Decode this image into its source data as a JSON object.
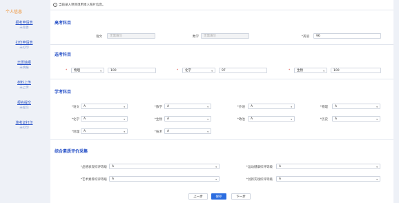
{
  "sidebar": {
    "header": "个人信息",
    "items": [
      {
        "title": "报考申请表",
        "status": "未完善"
      },
      {
        "title": "打印申请表",
        "status": "未打印"
      },
      {
        "title": "志愿填报",
        "status": "未填报"
      },
      {
        "title": "材料上传",
        "status": "未上传"
      },
      {
        "title": "报名提交",
        "status": "未提交"
      },
      {
        "title": "准考证打印",
        "status": "未打印"
      }
    ]
  },
  "notice": "当前录入项目须用本人照片信息。",
  "sections": {
    "gaokao": {
      "title": "高考科目",
      "chinese_label": "语文",
      "chinese_value": "无需填写",
      "math_label": "数学",
      "math_value": "无需填写",
      "english_label": "*英语",
      "english_value": "96"
    },
    "xuankao": {
      "title": "选考科目",
      "subjects": [
        {
          "subject": "物理",
          "score": "100"
        },
        {
          "subject": "化学",
          "score": "97"
        },
        {
          "subject": "生物",
          "score": "100"
        }
      ]
    },
    "xuekao": {
      "title": "学考科目",
      "items": [
        {
          "label": "*语文",
          "value": "A"
        },
        {
          "label": "*数学",
          "value": "A"
        },
        {
          "label": "*外语",
          "value": "A"
        },
        {
          "label": "*物理",
          "value": "A"
        },
        {
          "label": "*化学",
          "value": "A"
        },
        {
          "label": "*生物",
          "value": "A"
        },
        {
          "label": "*政治",
          "value": "A"
        },
        {
          "label": "*历史",
          "value": "A"
        },
        {
          "label": "*地理",
          "value": "A"
        },
        {
          "label": "*技术",
          "value": "A"
        }
      ]
    },
    "zonghe": {
      "title": "综合素质评价采集",
      "items": [
        {
          "label": "*品德表现综评等级",
          "value": "A"
        },
        {
          "label": "*运动健康综评等级",
          "value": "A"
        },
        {
          "label": "*艺术素养综评等级",
          "value": "A"
        },
        {
          "label": "*创新实践综评等级",
          "value": "A"
        }
      ]
    }
  },
  "buttons": {
    "prev": "上一步",
    "save": "保存",
    "next": "下一步"
  },
  "colors": {
    "accent": "#2b6de0",
    "title_blue": "#2b54c8",
    "orange": "#f08a24",
    "required": "#e0453b"
  }
}
